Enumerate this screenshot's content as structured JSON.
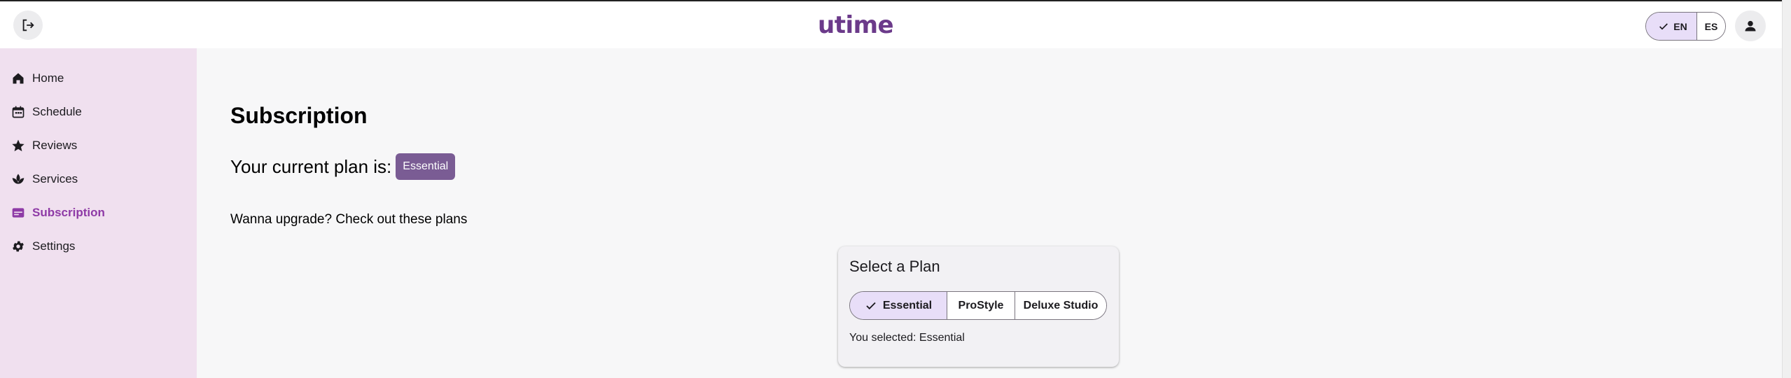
{
  "header": {
    "logo_text": "utime",
    "logout_icon": "logout-icon",
    "account_icon": "person-icon",
    "languages": [
      {
        "label": "EN",
        "selected": true
      },
      {
        "label": "ES",
        "selected": false
      }
    ]
  },
  "sidebar": {
    "items": [
      {
        "label": "Home",
        "icon": "home-icon"
      },
      {
        "label": "Schedule",
        "icon": "calendar-icon"
      },
      {
        "label": "Reviews",
        "icon": "star-icon"
      },
      {
        "label": "Services",
        "icon": "spa-icon"
      },
      {
        "label": "Subscription",
        "icon": "card-icon",
        "active": true
      },
      {
        "label": "Settings",
        "icon": "gear-icon"
      }
    ]
  },
  "main": {
    "title": "Subscription",
    "current_plan_label": "Your current plan is:",
    "current_plan": "Essential",
    "upgrade_text": "Wanna upgrade? Check out these plans",
    "plan_card": {
      "title": "Select a Plan",
      "options": [
        "Essential",
        "ProStyle",
        "Deluxe Studio"
      ],
      "selected_option": "Essential",
      "selected_text": "You selected: Essential"
    }
  },
  "colors": {
    "accent": "#8e3aa6",
    "sidebar_bg": "#f0e0ef",
    "badge_bg": "#7a5c94",
    "segment_selected": "#e8def8"
  }
}
